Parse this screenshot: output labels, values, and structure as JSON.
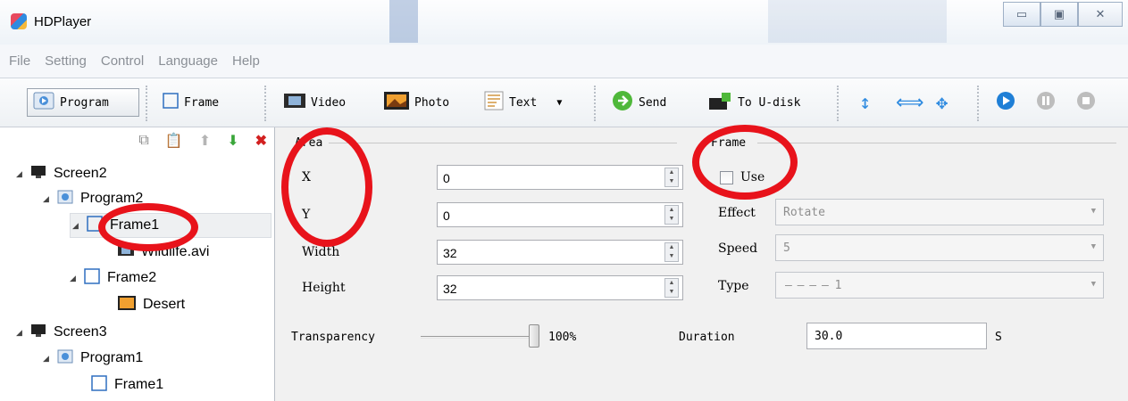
{
  "window": {
    "title": "HDPlayer"
  },
  "menu": [
    "File",
    "Setting",
    "Control",
    "Language",
    "Help"
  ],
  "toolbar": {
    "program": "Program",
    "frame": "Frame",
    "video": "Video",
    "photo": "Photo",
    "text": "Text",
    "send": "Send",
    "to_udisk": "To U-disk"
  },
  "tree": {
    "screen2": "Screen2",
    "program2": "Program2",
    "frame1": "Frame1",
    "wildlife": "Wildlife.avi",
    "frame2": "Frame2",
    "desert": "Desert",
    "screen3": "Screen3",
    "program1": "Program1",
    "frame1b": "Frame1"
  },
  "area": {
    "title": "Area",
    "x_label": "X",
    "x_value": "0",
    "y_label": "Y",
    "y_value": "0",
    "width_label": "Width",
    "width_value": "32",
    "height_label": "Height",
    "height_value": "32"
  },
  "frame_group": {
    "title": "Frame",
    "use_label": "Use",
    "use_checked": false,
    "effect_label": "Effect",
    "effect_value": "Rotate",
    "speed_label": "Speed",
    "speed_value": "5",
    "type_label": "Type",
    "type_value": "1"
  },
  "transparency": {
    "label": "Transparency",
    "value": "100%",
    "level": 1.0
  },
  "duration": {
    "label": "Duration",
    "value": "30.0",
    "unit": "S"
  },
  "colors": {
    "annotation": "#e8131b",
    "accent": "#2f8be0"
  }
}
